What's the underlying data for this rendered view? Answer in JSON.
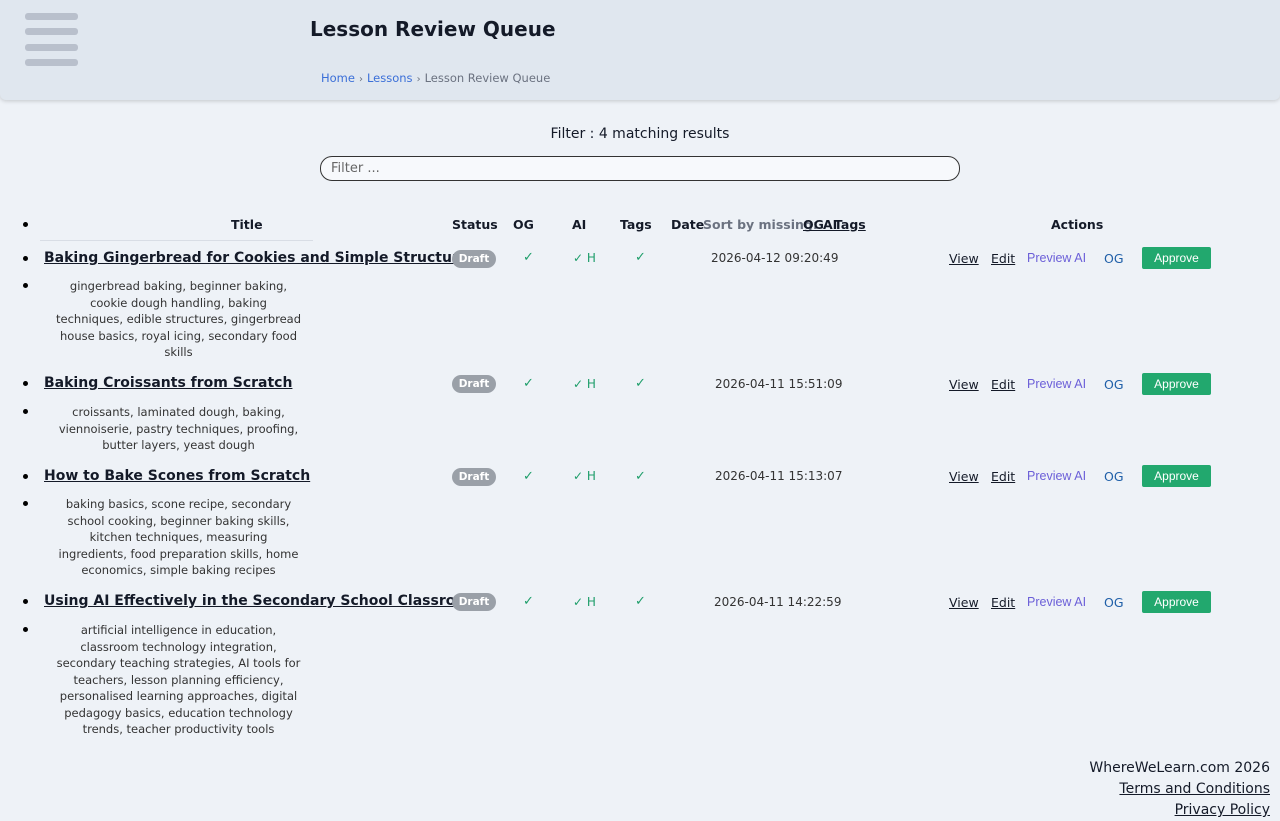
{
  "header": {
    "title": "Lesson Review Queue",
    "breadcrumb": [
      {
        "label": "Home"
      },
      {
        "label": "Lessons"
      },
      {
        "label": "Lesson Review Queue"
      }
    ],
    "breadcrumb_separator": "›"
  },
  "filter": {
    "status_label": "Filter : 4 matching results",
    "placeholder": "Filter ...",
    "value": ""
  },
  "columns": {
    "title": "Title",
    "status": "Status",
    "og": "OG",
    "ai": "AI",
    "tags": "Tags",
    "date": "Date",
    "actions": "Actions"
  },
  "sort": {
    "label": "Sort by missing:",
    "links": [
      "OG",
      "AI",
      "Tags"
    ]
  },
  "icons": {
    "check": "✓",
    "menu": "hamburger-menu-icon"
  },
  "colors": {
    "approve": "#22a86e",
    "draft_badge": "#9aa0a8",
    "check": "#1e9e6a",
    "preview_link": "#6b5fd8",
    "og_link": "#1f5fa8"
  },
  "lessons": [
    {
      "title": "Baking Gingerbread for Cookies and Simple Structures",
      "status": "Draft",
      "ai_flag": "H",
      "date": "2026-04-12 09:20:49",
      "tags": "gingerbread baking, beginner baking, cookie dough handling, baking techniques, edible structures, gingerbread house basics, royal icing, secondary food skills"
    },
    {
      "title": "Baking Croissants from Scratch",
      "status": "Draft",
      "ai_flag": "H",
      "date": "2026-04-11 15:51:09",
      "tags": "croissants, laminated dough, baking, viennoiserie, pastry techniques, proofing, butter layers, yeast dough"
    },
    {
      "title": "How to Bake Scones from Scratch",
      "status": "Draft",
      "ai_flag": "H",
      "date": "2026-04-11 15:13:07",
      "tags": "baking basics, scone recipe, secondary school cooking, beginner baking skills, kitchen techniques, measuring ingredients, food preparation skills, home economics, simple baking recipes"
    },
    {
      "title": "Using AI Effectively in the Secondary School Classroom",
      "status": "Draft",
      "ai_flag": "H",
      "date": "2026-04-11 14:22:59",
      "tags": "artificial intelligence in education, classroom technology integration, secondary teaching strategies, AI tools for teachers, lesson planning efficiency, personalised learning approaches, digital pedagogy basics, education technology trends, teacher productivity tools"
    }
  ],
  "actions": {
    "view": "View",
    "edit": "Edit",
    "preview_ai": "Preview AI",
    "og": "OG",
    "approve": "Approve"
  },
  "footer": {
    "brand": "WhereWeLearn.com 2026",
    "terms": "Terms and Conditions",
    "privacy": "Privacy Policy"
  }
}
